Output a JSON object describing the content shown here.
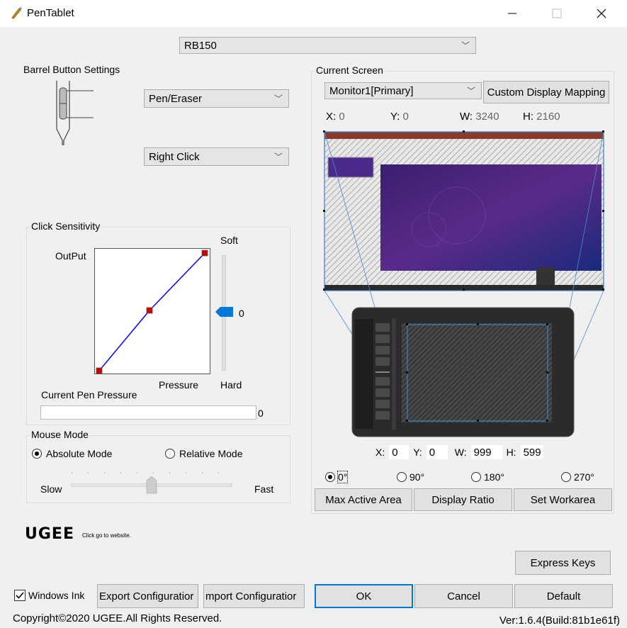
{
  "window": {
    "title": "PenTablet"
  },
  "device": {
    "selected": "RB150"
  },
  "barrel": {
    "group_label": "Barrel Button Settings",
    "button1": "Pen/Eraser",
    "button2": "Right Click"
  },
  "sensitivity": {
    "group_label": "Click Sensitivity",
    "output_label": "OutPut",
    "pressure_label": "Pressure",
    "soft_label": "Soft",
    "hard_label": "Hard",
    "slider_value": "0",
    "current_pressure_label": "Current Pen Pressure",
    "current_pressure_value": "0"
  },
  "mouse_mode": {
    "group_label": "Mouse Mode",
    "absolute": "Absolute Mode",
    "relative": "Relative Mode",
    "selected": "absolute",
    "slow": "Slow",
    "fast": "Fast"
  },
  "screen": {
    "group_label": "Current Screen",
    "monitor": "Monitor1[Primary]",
    "custom_mapping": "Custom Display Mapping",
    "x_label": "X:",
    "x": "0",
    "y_label": "Y:",
    "y": "0",
    "w_label": "W:",
    "w": "3240",
    "h_label": "H:",
    "h": "2160"
  },
  "tablet_area": {
    "x_label": "X:",
    "x": "0",
    "y_label": "Y:",
    "y": "0",
    "w_label": "W:",
    "w": "999",
    "h_label": "H:",
    "h": "599"
  },
  "rotation": {
    "options": [
      "0°",
      "90°",
      "180°",
      "270°"
    ],
    "selected": "0°"
  },
  "area_buttons": {
    "max": "Max Active Area",
    "ratio": "Display Ratio",
    "set": "Set Workarea"
  },
  "branding": {
    "logo": "UGEE",
    "link": "Click go to website."
  },
  "express_keys": "Express Keys",
  "bottom": {
    "windows_ink": "Windows Ink",
    "export": "Export Configuratior",
    "import": "mport Configuratior",
    "ok": "OK",
    "cancel": "Cancel",
    "default": "Default"
  },
  "footer": {
    "copyright": "Copyright©2020 UGEE.All Rights Reserved.",
    "version": "Ver:1.6.4(Build:81b1e61f)"
  },
  "colors": {
    "curve": "#0000ff",
    "point": "#d00000",
    "accent_handle": "#0078d7"
  }
}
